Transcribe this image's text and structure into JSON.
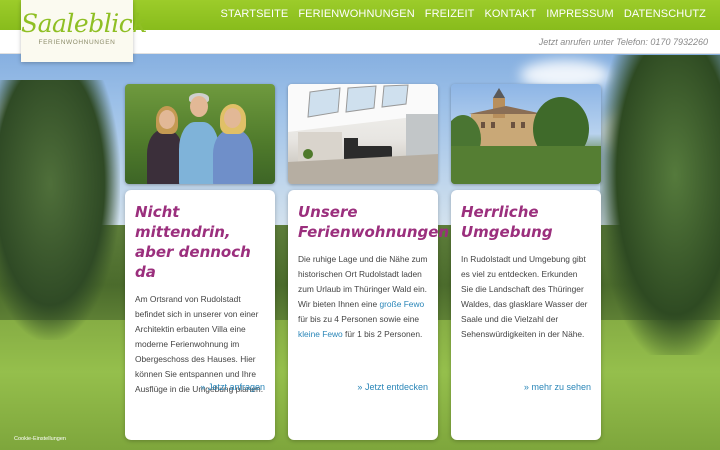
{
  "logo": {
    "name": "Saaleblick",
    "subtitle": "Ferienwohnungen"
  },
  "nav": [
    "STARTSEITE",
    "FERIENWOHNUNGEN",
    "FREIZEIT",
    "KONTAKT",
    "IMPRESSUM",
    "DATENSCHUTZ"
  ],
  "phone_line": "Jetzt anrufen unter Telefon: 0170 7932260",
  "cards": [
    {
      "title_line1": "Nicht mittendrin,",
      "title_line2": "aber dennoch da",
      "text": "Am Ortsrand von Rudolstadt befindet sich in unserer von einer Architektin erbauten Villa eine moderne Ferienwohnung im Obergeschoss des Hauses. Hier können Sie entspannen und Ihre Ausflüge in die Umgebung planen.",
      "link_arrow": "»",
      "link_label": "Jetzt anfragen"
    },
    {
      "title_line1": "Unsere",
      "title_line2": "Ferienwohnungen",
      "text_a": "Die ruhige Lage und die Nähe zum historischen Ort Rudolstadt laden zum Urlaub im Thüringer Wald ein. Wir bieten Ihnen eine ",
      "link_a": "große Fewo",
      "text_b": " für bis zu 4 Personen sowie eine ",
      "link_b": "kleine Fewo",
      "text_c": " für 1 bis 2 Personen.",
      "link_arrow": "»",
      "link_label": "Jetzt entdecken"
    },
    {
      "title_line1": "Herrliche",
      "title_line2": "Umgebung",
      "text": "In Rudolstadt und Umgebung gibt es viel zu entdecken. Erkunden Sie die Landschaft des Thüringer Waldes, das glasklare Wasser der Saale und die Vielzahl der Sehenswürdigkeiten in der Nähe.",
      "link_arrow": "»",
      "link_label": "mehr zu sehen"
    }
  ],
  "cookie_link": "Cookie-Einstellungen",
  "colors": {
    "brand_green": "#8fbf24",
    "title_purple": "#9b2f7d",
    "link_blue": "#2a86b8"
  }
}
